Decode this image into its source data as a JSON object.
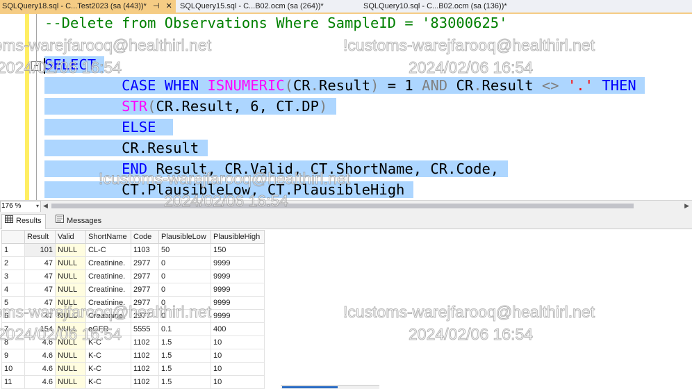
{
  "tabs": [
    {
      "label": "SQLQuery18.sql - C...Test2023 (sa (443))*",
      "active": true,
      "pin": "⊣",
      "close": "✕"
    },
    {
      "label": "SQLQuery15.sql - C...B02.ocm (sa (264))*",
      "active": false
    },
    {
      "label": "SQLQuery10.sql - C...B02.ocm (sa (136))*",
      "active": false
    }
  ],
  "editor": {
    "comment": "--Delete from Observations Where SampleID = '83000625'",
    "select": "SELECT",
    "case_kw": "CASE",
    "when_kw": "WHEN",
    "isnumeric_fn": "ISNUMERIC",
    "open_paren": "(",
    "cr": "CR",
    "dot": ".",
    "result_col": "Result",
    "close_paren": ")",
    "eq_one": " = 1 ",
    "and_kw": "AND",
    "neq": " <> ",
    "dot_str": "'.'",
    "then_kw": "THEN",
    "str_fn": "STR",
    "dp_args": "CR.Result, 6, CT.DP",
    "else_kw": "ELSE",
    "cr_result": "CR.Result",
    "end_kw": "END",
    "end_line_rest": " Result, CR.Valid, CT.ShortName, CR.Code,",
    "last_line": "CT.PlausibleLow, CT.PlausibleHigh",
    "fold_symbol": "−"
  },
  "zoom": {
    "value": "176 %",
    "arrow": "▾"
  },
  "scroll": {
    "left": "◀",
    "right": "▶"
  },
  "result_tabs": {
    "results": "Results",
    "messages": "Messages"
  },
  "grid": {
    "columns": [
      "",
      "Result",
      "Valid",
      "ShortName",
      "Code",
      "PlausibleLow",
      "PlausibleHigh"
    ],
    "rows": [
      [
        "1",
        "101",
        "NULL",
        "CL-C",
        "1103",
        "50",
        "150"
      ],
      [
        "2",
        "47",
        "NULL",
        "Creatinine.",
        "2977",
        "0",
        "9999"
      ],
      [
        "3",
        "47",
        "NULL",
        "Creatinine.",
        "2977",
        "0",
        "9999"
      ],
      [
        "4",
        "47",
        "NULL",
        "Creatinine.",
        "2977",
        "0",
        "9999"
      ],
      [
        "5",
        "47",
        "NULL",
        "Creatinine.",
        "2977",
        "0",
        "9999"
      ],
      [
        "6",
        "47",
        "NULL",
        "Creatinine.",
        "2977",
        "0",
        "9999"
      ],
      [
        "7",
        "154",
        "NULL",
        "eGFR",
        "5555",
        "0.1",
        "400"
      ],
      [
        "8",
        "4.6",
        "NULL",
        "K-C",
        "1102",
        "1.5",
        "10"
      ],
      [
        "9",
        "4.6",
        "NULL",
        "K-C",
        "1102",
        "1.5",
        "10"
      ],
      [
        "10",
        "4.6",
        "NULL",
        "K-C",
        "1102",
        "1.5",
        "10"
      ],
      [
        "11",
        "4.6",
        "NULL",
        "K-C",
        "1102",
        "1.5",
        "10"
      ]
    ]
  },
  "watermark": {
    "user": "!customs-warejfarooq@healthirl.net",
    "datetime": "2024/02/06 16:54"
  }
}
